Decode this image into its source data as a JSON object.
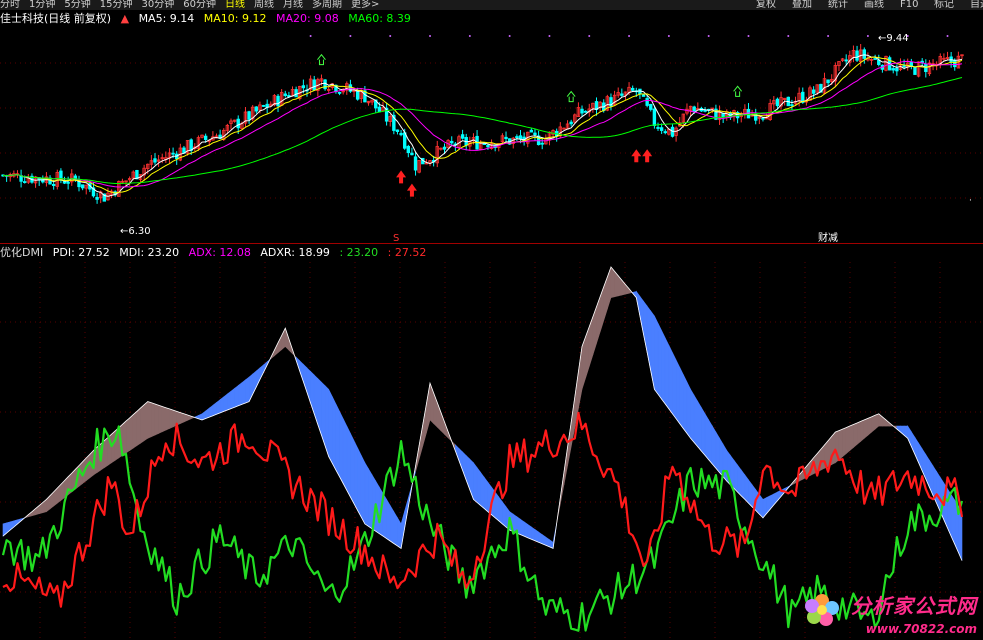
{
  "toolbar": {
    "timeframes": [
      "分时",
      "1分钟",
      "5分钟",
      "15分钟",
      "30分钟",
      "60分钟",
      "日线",
      "周线",
      "月线",
      "多周期",
      "更多>"
    ],
    "active_index": 6,
    "right_buttons": [
      "复权",
      "叠加",
      "统计",
      "画线",
      "F10",
      "标记",
      "自选"
    ]
  },
  "price_legend": {
    "title": "佳士科技(日线 前复权)",
    "ma5": "MA5: 9.14",
    "ma10": "MA10: 9.12",
    "ma20": "MA20: 9.08",
    "ma60": "MA60: 8.39"
  },
  "price_annotations": {
    "high": "9.44",
    "low": "6.30",
    "financial": "财减",
    "signal_s": "S"
  },
  "dmi_legend": {
    "title": "优化DMI",
    "pdi": "PDI: 27.52",
    "mdi": "MDI: 23.20",
    "adx": "ADX: 12.08",
    "adxr": "ADXR: 18.99",
    "v1": ": 23.20",
    "v2": ": 27.52"
  },
  "watermark": {
    "line1": "分析家公式网",
    "line2": "www.70822.com"
  },
  "colors": {
    "up": "#ff3232",
    "down": "#00ffff",
    "ma5": "#ffffff",
    "ma10": "#ffff00",
    "ma20": "#ff00ff",
    "ma60": "#00ff00",
    "pdi": "#ff1a1a",
    "mdi": "#22dd22",
    "adx_band_up": "#8a6a6a",
    "adx_band_down": "#4a7fff"
  },
  "chart_data": [
    {
      "type": "candlestick",
      "series_names": [
        "MA5",
        "MA10",
        "MA20",
        "MA60"
      ],
      "ylim": [
        6.0,
        9.6
      ],
      "price_keypoints": [
        [
          0,
          7.0
        ],
        [
          20,
          6.9
        ],
        [
          28,
          6.6
        ],
        [
          40,
          7.2
        ],
        [
          60,
          7.8
        ],
        [
          80,
          8.6
        ],
        [
          88,
          8.8
        ],
        [
          100,
          8.5
        ],
        [
          110,
          7.8
        ],
        [
          114,
          7.2
        ],
        [
          125,
          7.6
        ],
        [
          150,
          7.7
        ],
        [
          160,
          8.2
        ],
        [
          175,
          8.6
        ],
        [
          180,
          8.0
        ],
        [
          185,
          7.8
        ],
        [
          190,
          8.3
        ],
        [
          200,
          8.1
        ],
        [
          210,
          8.2
        ],
        [
          225,
          8.6
        ],
        [
          235,
          9.3
        ],
        [
          250,
          9.0
        ],
        [
          265,
          9.2
        ]
      ]
    },
    {
      "type": "line",
      "series_names": [
        "PDI",
        "MDI",
        "ADX",
        "ADXR"
      ],
      "ylim": [
        0,
        60
      ],
      "pdi_keypoints": [
        [
          0,
          10
        ],
        [
          15,
          5
        ],
        [
          30,
          25
        ],
        [
          35,
          16
        ],
        [
          45,
          33
        ],
        [
          55,
          28
        ],
        [
          68,
          33
        ],
        [
          80,
          25
        ],
        [
          92,
          18
        ],
        [
          100,
          14
        ],
        [
          108,
          8
        ],
        [
          120,
          16
        ],
        [
          128,
          8
        ],
        [
          140,
          28
        ],
        [
          150,
          31
        ],
        [
          160,
          34
        ],
        [
          170,
          24
        ],
        [
          178,
          10
        ],
        [
          185,
          28
        ],
        [
          195,
          16
        ],
        [
          205,
          14
        ],
        [
          210,
          28
        ],
        [
          218,
          23
        ],
        [
          230,
          30
        ],
        [
          240,
          22
        ],
        [
          250,
          26
        ],
        [
          265,
          22
        ]
      ],
      "mdi_keypoints": [
        [
          0,
          15
        ],
        [
          10,
          12
        ],
        [
          25,
          30
        ],
        [
          32,
          34
        ],
        [
          38,
          18
        ],
        [
          48,
          6
        ],
        [
          60,
          16
        ],
        [
          70,
          9
        ],
        [
          80,
          15
        ],
        [
          90,
          6
        ],
        [
          98,
          12
        ],
        [
          110,
          30
        ],
        [
          118,
          18
        ],
        [
          128,
          8
        ],
        [
          140,
          17
        ],
        [
          150,
          4
        ],
        [
          160,
          3
        ],
        [
          170,
          7
        ],
        [
          180,
          12
        ],
        [
          190,
          25
        ],
        [
          200,
          24
        ],
        [
          210,
          12
        ],
        [
          218,
          3
        ],
        [
          225,
          7
        ],
        [
          240,
          2
        ],
        [
          250,
          18
        ],
        [
          265,
          22
        ]
      ],
      "adx_keypoints": [
        [
          0,
          16
        ],
        [
          12,
          22
        ],
        [
          25,
          30
        ],
        [
          40,
          38
        ],
        [
          55,
          35
        ],
        [
          68,
          38
        ],
        [
          78,
          50
        ],
        [
          90,
          29
        ],
        [
          100,
          18
        ],
        [
          110,
          14
        ],
        [
          118,
          41
        ],
        [
          130,
          22
        ],
        [
          140,
          17
        ],
        [
          152,
          14
        ],
        [
          160,
          47
        ],
        [
          168,
          60
        ],
        [
          175,
          55
        ],
        [
          180,
          40
        ],
        [
          190,
          32
        ],
        [
          200,
          25
        ],
        [
          210,
          19
        ],
        [
          230,
          33
        ],
        [
          242,
          36
        ],
        [
          250,
          32
        ],
        [
          265,
          12
        ]
      ],
      "adxr_keypoints": [
        [
          0,
          18
        ],
        [
          12,
          20
        ],
        [
          25,
          26
        ],
        [
          40,
          32
        ],
        [
          55,
          36
        ],
        [
          68,
          42
        ],
        [
          78,
          47
        ],
        [
          90,
          40
        ],
        [
          100,
          28
        ],
        [
          110,
          18
        ],
        [
          118,
          35
        ],
        [
          130,
          28
        ],
        [
          140,
          20
        ],
        [
          152,
          15
        ],
        [
          160,
          40
        ],
        [
          168,
          55
        ],
        [
          175,
          56
        ],
        [
          180,
          52
        ],
        [
          190,
          40
        ],
        [
          200,
          30
        ],
        [
          210,
          22
        ],
        [
          230,
          28
        ],
        [
          242,
          34
        ],
        [
          250,
          34
        ],
        [
          265,
          20
        ]
      ]
    }
  ]
}
